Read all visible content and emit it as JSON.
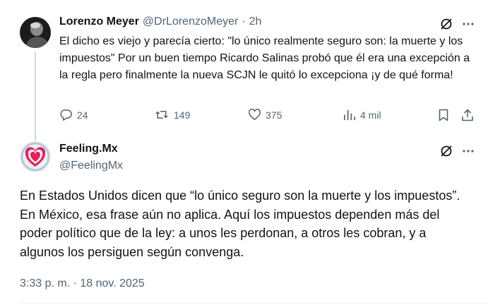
{
  "reply": {
    "author_name": "Lorenzo Meyer",
    "author_handle": "@DrLorenzoMeyer",
    "separator": "·",
    "time_ago": "2h",
    "text": "El dicho es viejo y parecía cierto: \"lo único realmente seguro son: la muerte y los impuestos\" Por un buen tiempo Ricardo Salinas probó que  él era una excepción a la regla pero finalmente la nueva SCJN le quitó lo excepciona ¡y de qué forma!",
    "actions": {
      "replies": "24",
      "reposts": "149",
      "likes": "375",
      "views": "4 mil"
    }
  },
  "main_post": {
    "author_name": "Feeling.Mx",
    "author_handle": "@FeelingMx",
    "text": "En Estados Unidos dicen que “lo único seguro son la muerte y los impuestos”. En México, esa frase aún no aplica. Aquí los impuestos dependen más del poder político que de la ley: a unos les perdonan, a otros les cobran, y a algunos los persiguen según convenga.",
    "timestamp": "3:33 p. m. · 18 nov. 2025"
  },
  "icons": {
    "grok": "grok-icon",
    "more": "more-icon",
    "reply": "reply-icon",
    "repost": "repost-icon",
    "like": "like-icon",
    "views": "views-icon",
    "bookmark": "bookmark-icon",
    "share": "share-icon"
  },
  "colors": {
    "text": "#0f1419",
    "secondary": "#536471",
    "thread_line": "#cfd9de",
    "avatar_accent": "#e0245e"
  }
}
